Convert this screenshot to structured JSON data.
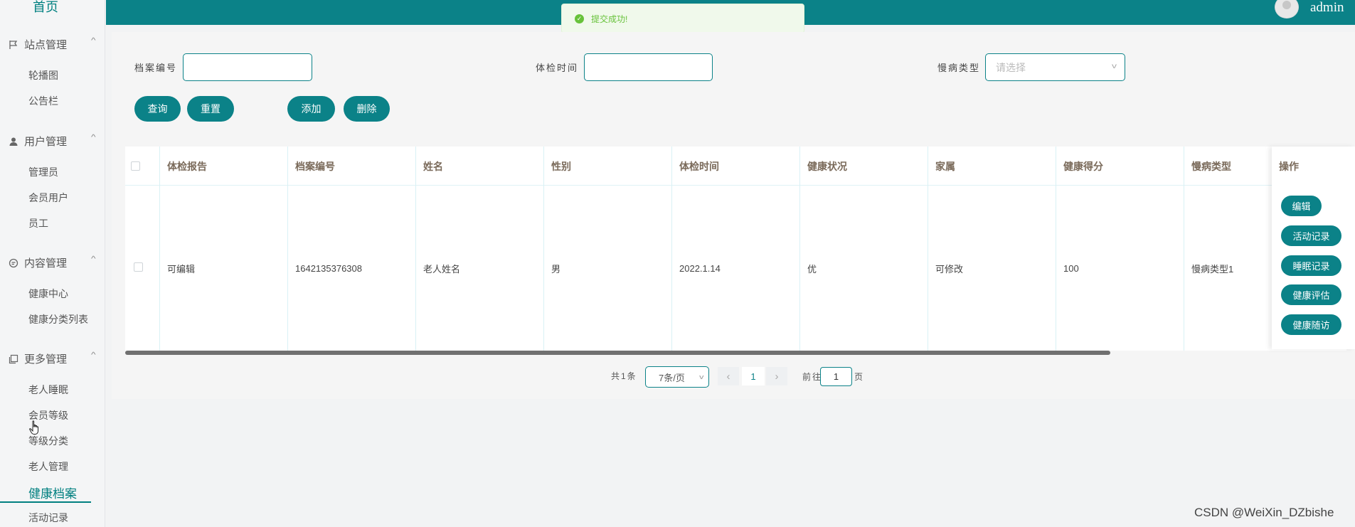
{
  "sidebar": {
    "home": "首页",
    "groups": [
      {
        "label": "站点管理",
        "items": [
          "轮播图",
          "公告栏"
        ]
      },
      {
        "label": "用户管理",
        "items": [
          "管理员",
          "会员用户",
          "员工"
        ]
      },
      {
        "label": "内容管理",
        "items": [
          "健康中心",
          "健康分类列表"
        ]
      },
      {
        "label": "更多管理",
        "items": [
          "老人睡眠",
          "会员等级",
          "等级分类",
          "老人管理"
        ]
      }
    ],
    "active": "健康档案",
    "after_active": "活动记录"
  },
  "header": {
    "user": "admin"
  },
  "toast": {
    "message": "提交成功!",
    "color": "#67c23a"
  },
  "filters": {
    "record_no_label": "档案编号",
    "exam_time_label": "体检时间",
    "disease_type_label": "慢病类型",
    "disease_type_placeholder": "请选择"
  },
  "buttons": {
    "query": "查询",
    "reset": "重置",
    "add": "添加",
    "delete": "删除"
  },
  "table": {
    "columns": [
      "体检报告",
      "档案编号",
      "姓名",
      "性别",
      "体检时间",
      "健康状况",
      "家属",
      "健康得分",
      "慢病类型",
      "操作"
    ],
    "rows": [
      {
        "report": "可编辑",
        "record_no": "1642135376308",
        "name": "老人姓名",
        "gender": "男",
        "exam_time": "2022.1.14",
        "status": "优",
        "family": "可修改",
        "score": "100",
        "disease_type": "慢病类型1"
      }
    ],
    "row_actions": [
      "编辑",
      "活动记录",
      "睡眠记录",
      "健康评估",
      "健康随访"
    ]
  },
  "pagination": {
    "total": "共1条",
    "page_size": "7条/页",
    "current": "1",
    "goto_label": "前往",
    "goto_value": "1",
    "page_suffix": "页"
  },
  "watermark": "CSDN @WeiXin_DZbishe",
  "colors": {
    "primary": "#0b8288",
    "active": "#008080"
  }
}
